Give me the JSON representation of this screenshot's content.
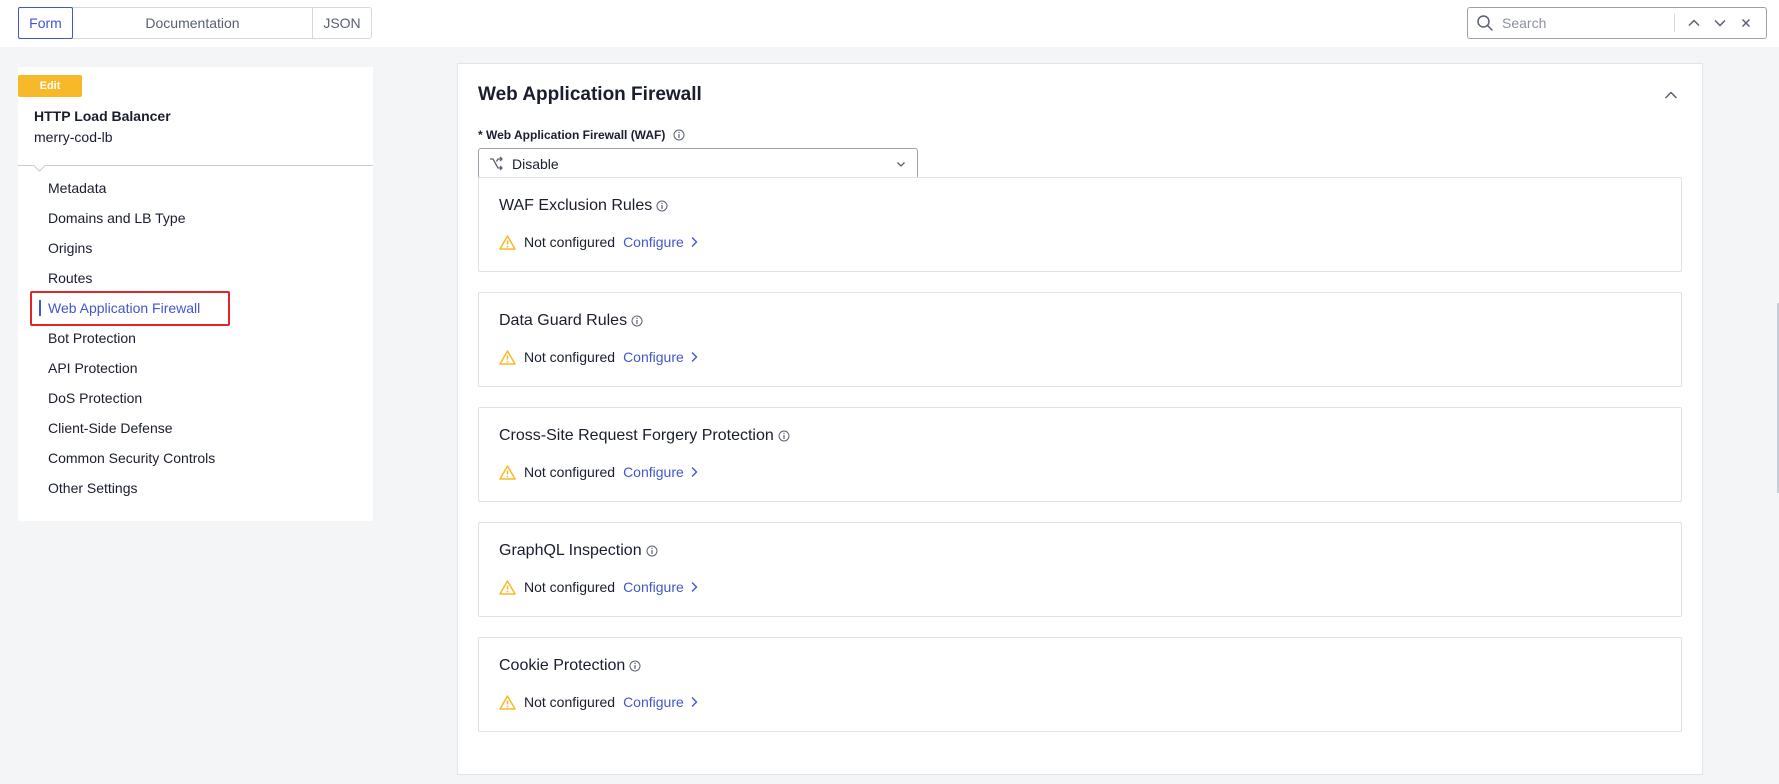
{
  "toolbar": {
    "tabs": [
      "Form",
      "Documentation",
      "JSON"
    ],
    "active_tab": "Form",
    "search": {
      "placeholder": "Search",
      "value": ""
    }
  },
  "sidebar": {
    "badge": "Edit",
    "title": "HTTP Load Balancer",
    "subtitle": "merry-cod-lb",
    "items": [
      {
        "label": "Metadata"
      },
      {
        "label": "Domains and LB Type"
      },
      {
        "label": "Origins"
      },
      {
        "label": "Routes"
      },
      {
        "label": "Web Application Firewall",
        "active": true
      },
      {
        "label": "Bot Protection"
      },
      {
        "label": "API Protection"
      },
      {
        "label": "DoS Protection"
      },
      {
        "label": "Client-Side Defense"
      },
      {
        "label": "Common Security Controls"
      },
      {
        "label": "Other Settings"
      }
    ]
  },
  "main": {
    "title": "Web Application Firewall",
    "waf_field": {
      "label": "* Web Application Firewall (WAF)",
      "value": "Disable"
    },
    "sections": [
      {
        "title": "WAF Exclusion Rules",
        "status": "Not configured",
        "action": "Configure"
      },
      {
        "title": "Data Guard Rules",
        "status": "Not configured",
        "action": "Configure"
      },
      {
        "title": "Cross-Site Request Forgery Protection",
        "status": "Not configured",
        "action": "Configure"
      },
      {
        "title": "GraphQL Inspection",
        "status": "Not configured",
        "action": "Configure"
      },
      {
        "title": "Cookie Protection",
        "status": "Not configured",
        "action": "Configure"
      }
    ]
  },
  "colors": {
    "accent": "#4256d0",
    "warning": "#f7b928",
    "highlight": "#e0262b"
  },
  "icons": {
    "search": "search-icon",
    "nav_up": "chevron-up-icon",
    "nav_down": "chevron-down-icon",
    "close": "close-icon",
    "collapse": "chevron-up-icon",
    "info": "info-icon",
    "select": "branch-icon",
    "warning": "warning-icon",
    "configure": "chevron-right-icon"
  }
}
